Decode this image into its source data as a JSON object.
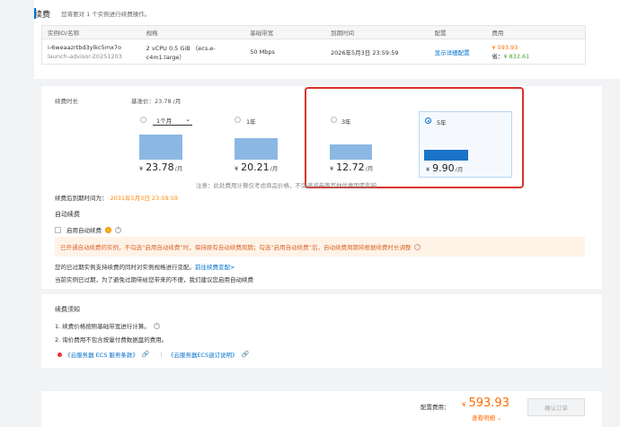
{
  "header": {
    "title": "续费",
    "subtitle": "您将要对 1 个实例进行续费操作。"
  },
  "table": {
    "columns": [
      "实例ID/名称",
      "规格",
      "基础带宽",
      "到期时间",
      "配置",
      "费用"
    ],
    "row": {
      "id": "i-6weaazrtbd3ylkc5mx7o",
      "name": "launch-advisor-20251203",
      "spec": "2 vCPU 0.5 GiB （ecs.e-c4m1.large）",
      "bandwidth": "50 Mbps",
      "expire": "2026年5月3日 23:59:59",
      "config_link": "显示详细配置",
      "fee_original": "¥ 593.93",
      "fee_save_label": "省：",
      "fee_save_value": "¥ 832.61"
    }
  },
  "renew": {
    "duration_label": "续费时长",
    "base_price": "基准价：23.78 /月",
    "options": [
      {
        "label": "1个月",
        "price": "23.78",
        "unit": "/月",
        "selected": false,
        "relative_height": 0.85
      },
      {
        "label": "1年",
        "price": "20.21",
        "unit": "/月",
        "selected": false,
        "relative_height": 0.74
      },
      {
        "label": "3年",
        "price": "12.72",
        "unit": "/月",
        "selected": false,
        "relative_height": 0.52
      },
      {
        "label": "5年",
        "price": "9.90",
        "unit": "/月",
        "selected": true,
        "relative_height": 0.35
      }
    ],
    "currency": "¥",
    "note": "注意：此处费用计算仅考虑商品价格，不受满减券等其他优惠因素影响",
    "expire_after_label": "续费后到期时间为：",
    "expire_after_value": "2031年5月3日 23:59:59",
    "auto_renew_title": "自动续费",
    "auto_renew_checkbox": "启用自动续费",
    "warning": "已开通自动续费的实例，不勾选“启用自动续费”时，保持原有自动续费周期；勾选“启用自动续费”后，自动续费周期将根据续费时长调整",
    "info_line1": "您的已过期实例支持续费的同时对实例规格进行变配。",
    "info_link": "前往续费变配>",
    "info_line2": "当前实例已过期，为了避免过期带给您带来的不便，我们建议您启用自动续费"
  },
  "notice": {
    "title": "续费须知",
    "item1": "1. 续费价格按照基础带宽进行计算。",
    "item2": "2. 询价费用不包含按量付费数据盘的费用。",
    "link1": "《云服务器 ECS 服务条款》",
    "link2": "《云服务器ECS退订说明》"
  },
  "footer": {
    "fee_label": "配置费用：",
    "fee_currency": "¥",
    "fee_value": "593.93",
    "detail_link": "查看明细",
    "confirm_button": "确认订单"
  },
  "colors": {
    "accent": "#0070cc",
    "price": "#ff6a00",
    "highlight_box": "#d9332b"
  }
}
